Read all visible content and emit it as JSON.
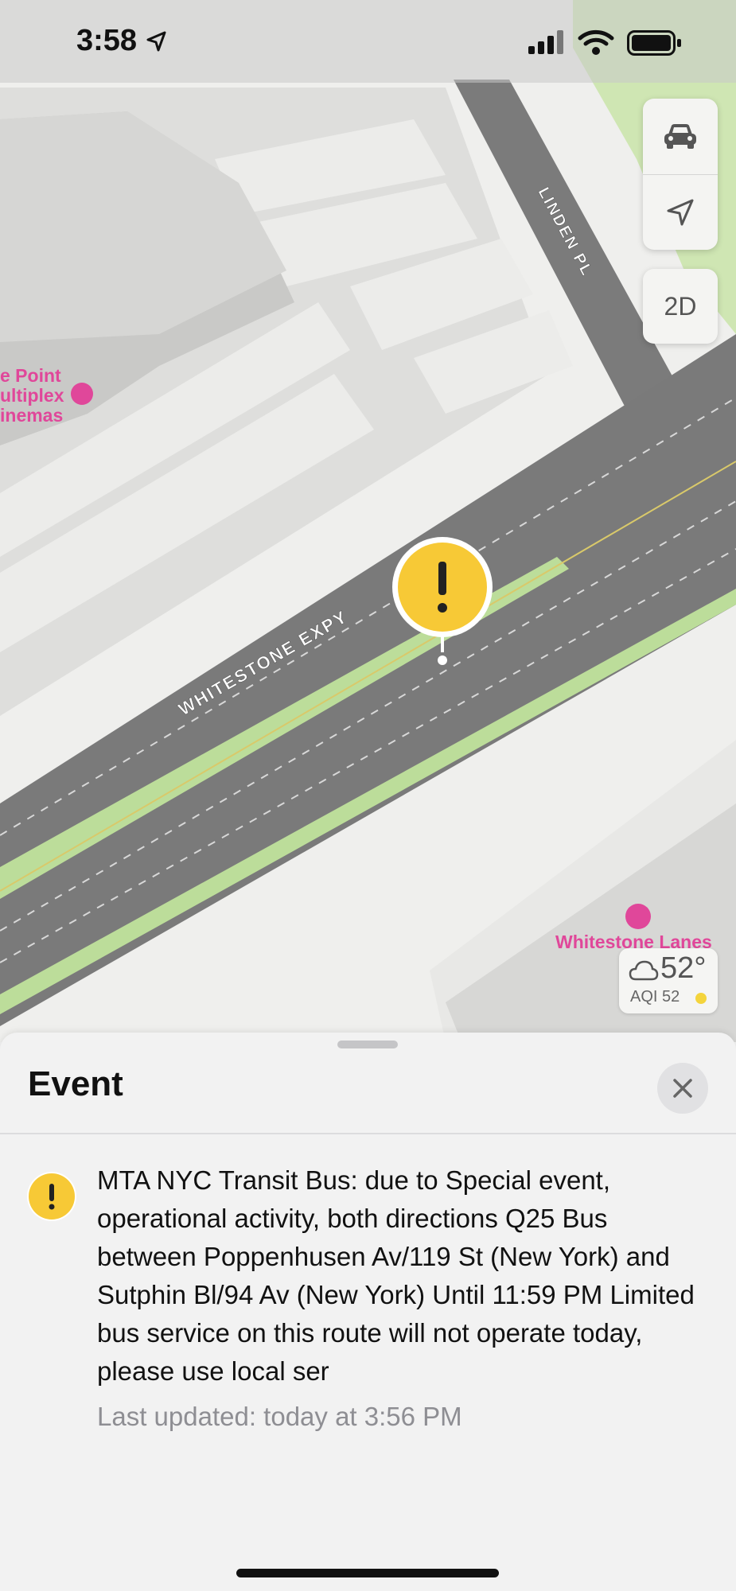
{
  "status_bar": {
    "time": "3:58"
  },
  "map": {
    "road_linden": "LINDEN PL",
    "road_whitestone": "WHITESTONE EXPY",
    "poi_cinemas": [
      "e Point",
      "ultiplex",
      "inemas"
    ],
    "poi_lanes": "Whitestone Lanes",
    "controls": {
      "drive_icon": "car-icon",
      "location_icon": "location-arrow-icon",
      "view_mode": "2D"
    },
    "weather": {
      "temperature": "52°",
      "aqi": "AQI 52"
    }
  },
  "sheet": {
    "title": "Event",
    "event": {
      "description": "MTA NYC Transit Bus: due to Special event, operational activity, both directions Q25 Bus between Poppenhusen Av/119 St (New York) and Sutphin Bl/94 Av (New York) Until 11:59 PM Limited bus service on this route will not operate today, please use local ser",
      "last_updated": "Last updated: today at 3:56 PM"
    }
  },
  "colors": {
    "warning": "#f7c936",
    "poi": "#e0479a",
    "road": "#777777",
    "green": "#bcdd9a"
  }
}
